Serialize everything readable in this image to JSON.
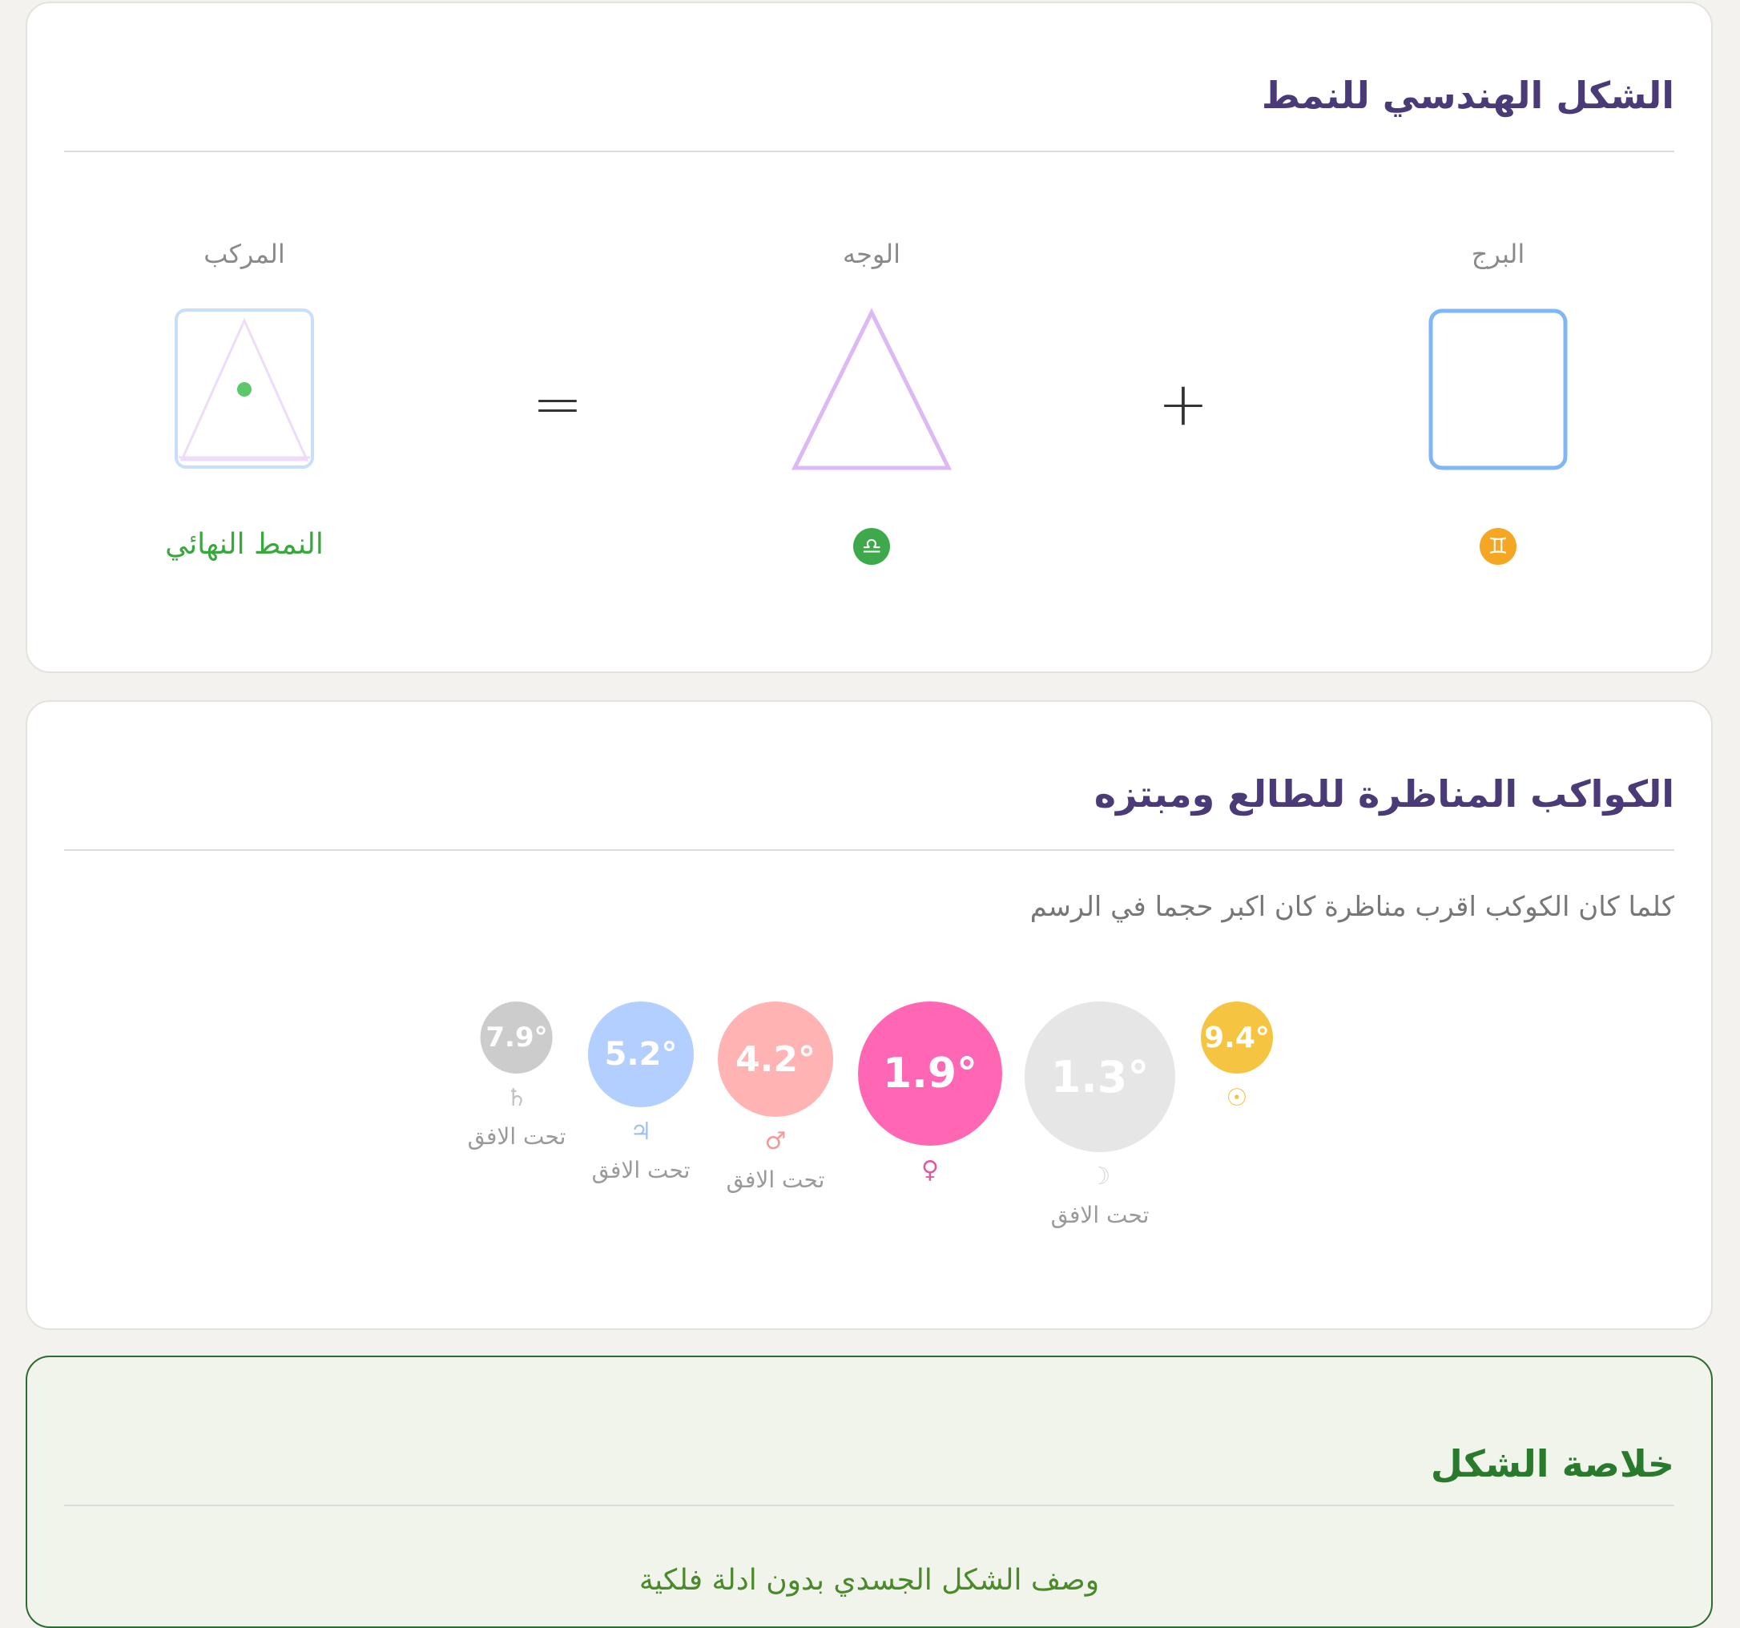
{
  "pattern": {
    "title": "الشكل الهندسي للنمط",
    "columns": {
      "sign": "البرج",
      "face": "الوجه",
      "composite": "المركب"
    },
    "plus": "+",
    "equals": "=",
    "sign_glyph": "♊",
    "face_glyph": "♎",
    "final_label": "النمط النهائي",
    "colors": {
      "square": "#7fb6f5",
      "triangle": "#dcb8f5",
      "dot": "#5cc86a",
      "sign_badge": "#f5a623",
      "face_badge": "#3da94a"
    }
  },
  "aspects": {
    "title": "الكواكب المناظرة للطالع ومبتزه",
    "subtitle": "كلما كان الكوكب اقرب مناظرة كان اكبر حجما في الرسم",
    "planets": [
      {
        "name": "sun",
        "degree": "9.4°",
        "symbol": "☉",
        "position": "",
        "color": "#f5c542",
        "symbol_color": "#f5c542"
      },
      {
        "name": "moon",
        "degree": "1.3°",
        "symbol": "☽",
        "position": "تحت الافق",
        "color": "#e6e6e6",
        "symbol_color": "#d8d8d8"
      },
      {
        "name": "venus",
        "degree": "1.9°",
        "symbol": "♀",
        "position": "",
        "color": "#ff66b3",
        "symbol_color": "#e05aa0"
      },
      {
        "name": "mars",
        "degree": "4.2°",
        "symbol": "♂",
        "position": "تحت الافق",
        "color": "#ffb3b3",
        "symbol_color": "#f29a9a"
      },
      {
        "name": "jupiter",
        "degree": "5.2°",
        "symbol": "♃",
        "position": "تحت الافق",
        "color": "#b3cfff",
        "symbol_color": "#9ebff5"
      },
      {
        "name": "saturn",
        "degree": "7.9°",
        "symbol": "♄",
        "position": "تحت الافق",
        "color": "#cccccc",
        "symbol_color": "#c2c2c2"
      }
    ]
  },
  "summary": {
    "title": "خلاصة الشكل",
    "text": "وصف الشكل الجسدي بدون ادلة فلكية"
  }
}
